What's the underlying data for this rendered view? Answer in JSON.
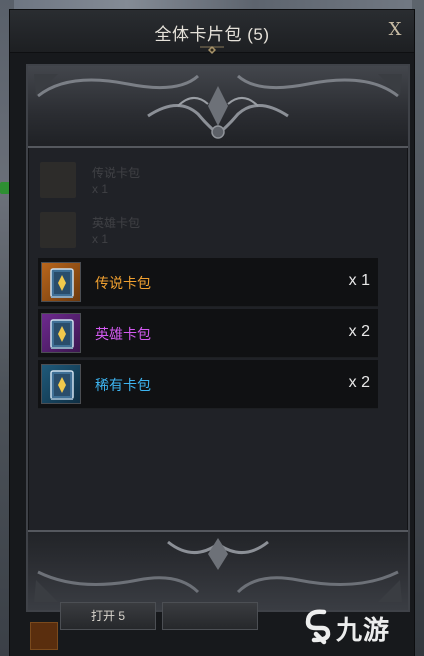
{
  "window": {
    "title": "全体卡片包 (5)",
    "close_label": "X"
  },
  "items": [
    {
      "name": "传说卡包",
      "qty": "x 1",
      "color": "#f0a030",
      "rarity": "legendary"
    },
    {
      "name": "英雄卡包",
      "qty": "x 2",
      "color": "#d25af0",
      "rarity": "heroic"
    },
    {
      "name": "稀有卡包",
      "qty": "x 2",
      "color": "#3db4f0",
      "rarity": "rare"
    }
  ],
  "ghost_items": [
    {
      "name": "传说卡包",
      "qty": "x 1"
    },
    {
      "name": "英雄卡包",
      "qty": "x 1"
    }
  ],
  "footer": {
    "open_button_label": "打开 5"
  },
  "watermark": {
    "text": "九游"
  },
  "icons": {
    "close": "close-icon",
    "card_pack": "card-pack-icon",
    "watermark_logo": "nine-game-logo-icon"
  }
}
